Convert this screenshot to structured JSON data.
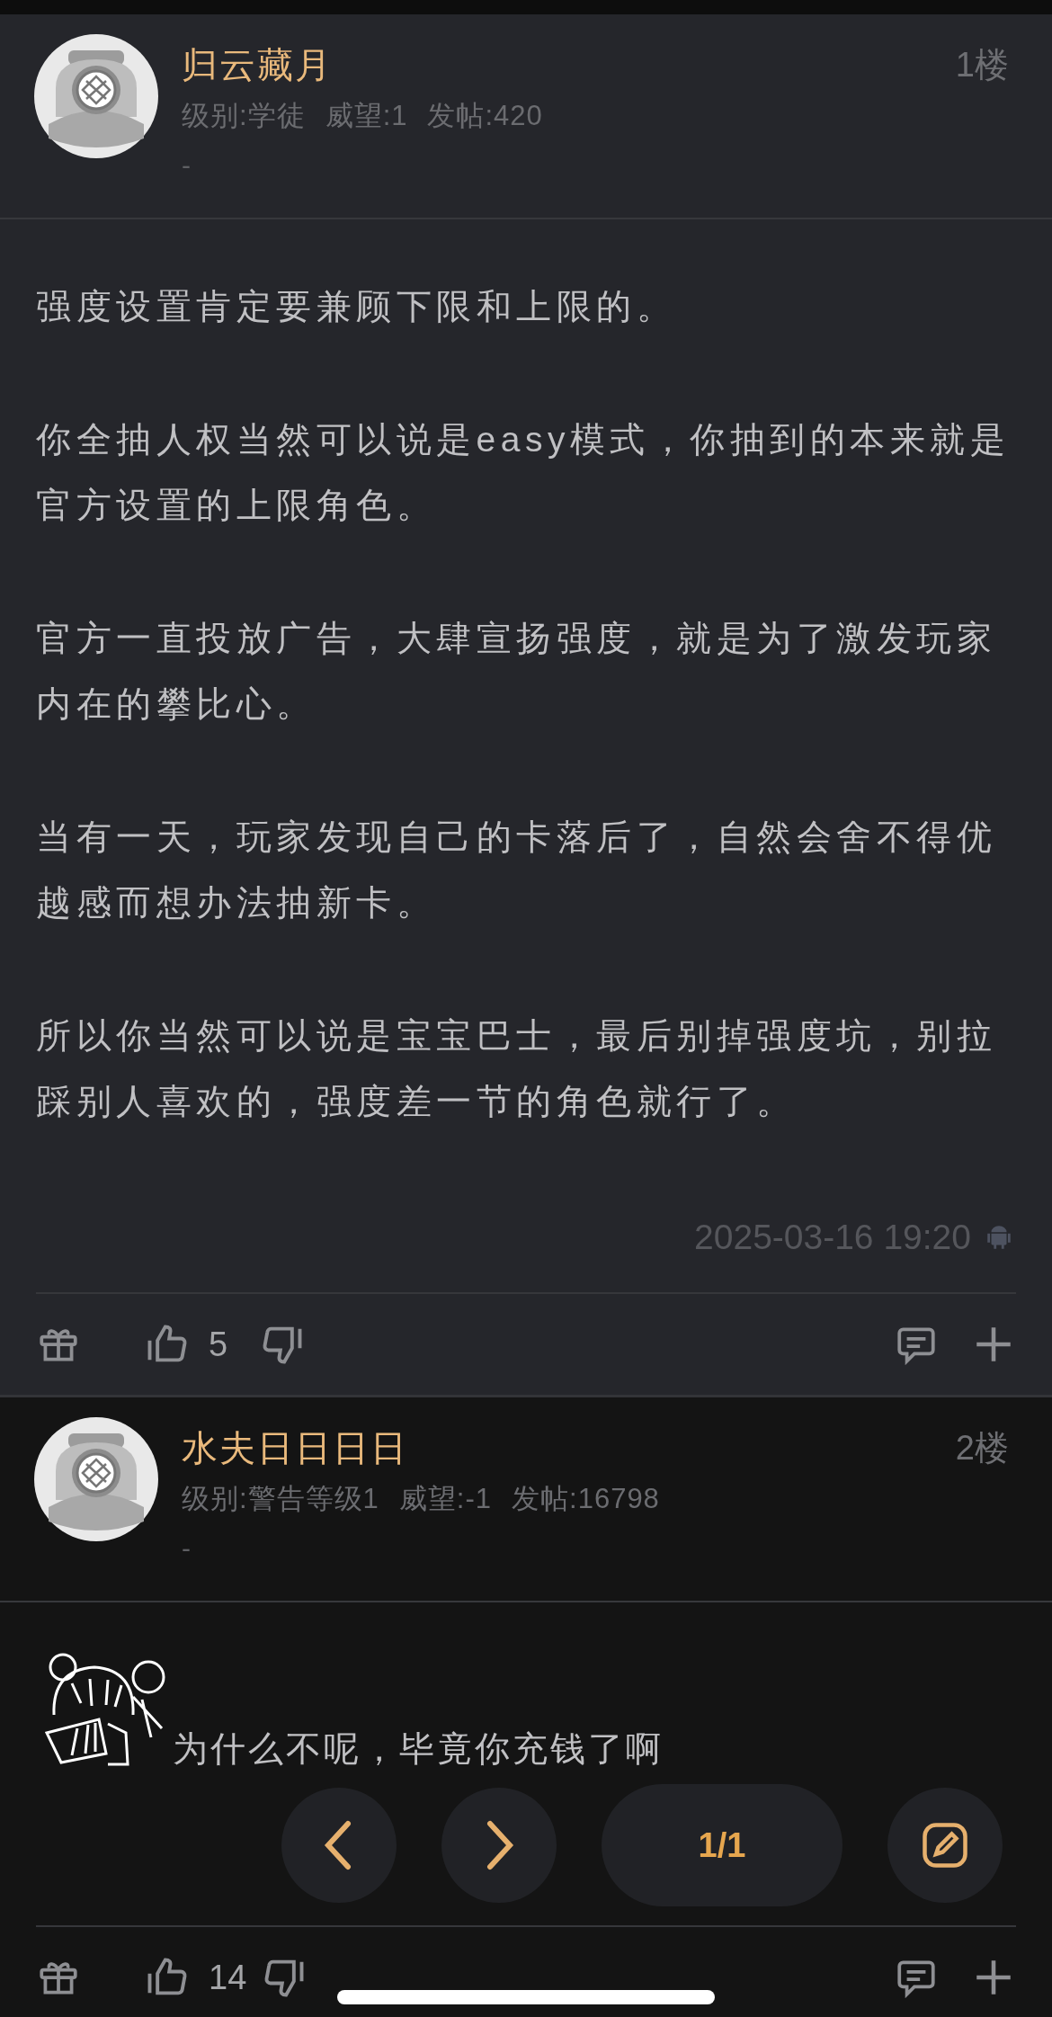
{
  "posts": [
    {
      "kind": "main",
      "author": "归云藏月",
      "floor": "1楼",
      "meta": [
        "级别:学徒",
        "威望:1",
        "发帖:420"
      ],
      "signature": "-",
      "content": [
        {
          "kind": "text",
          "text": "强度设置肯定要兼顾下限和上限的。"
        },
        {
          "kind": "text",
          "text": "你全抽人权当然可以说是easy模式，你抽到的本来就是官方设置的上限角色。"
        },
        {
          "kind": "text",
          "text": "官方一直投放广告，大肆宣扬强度，就是为了激发玩家内在的攀比心。"
        },
        {
          "kind": "text",
          "text": "当有一天，玩家发现自己的卡落后了，自然会舍不得优越感而想办法抽新卡。"
        },
        {
          "kind": "text",
          "text": "所以你当然可以说是宝宝巴士，最后别掉强度坑，别拉踩别人喜欢的，强度差一节的角色就行了。"
        }
      ],
      "timestamp": "2025-03-16 19:20",
      "device_icon": true,
      "likes": "5"
    },
    {
      "kind": "reply",
      "author": "水夫日日日日",
      "floor": "2楼",
      "meta": [
        "级别:警告等级1",
        "威望:-1",
        "发帖:16798"
      ],
      "signature": "-",
      "content": [
        {
          "kind": "sticker_text",
          "text": "为什么不呢，毕竟你充钱了啊"
        }
      ],
      "device_icon": false,
      "likes": "14"
    }
  ],
  "floating_nav": {
    "page": "1/1"
  }
}
